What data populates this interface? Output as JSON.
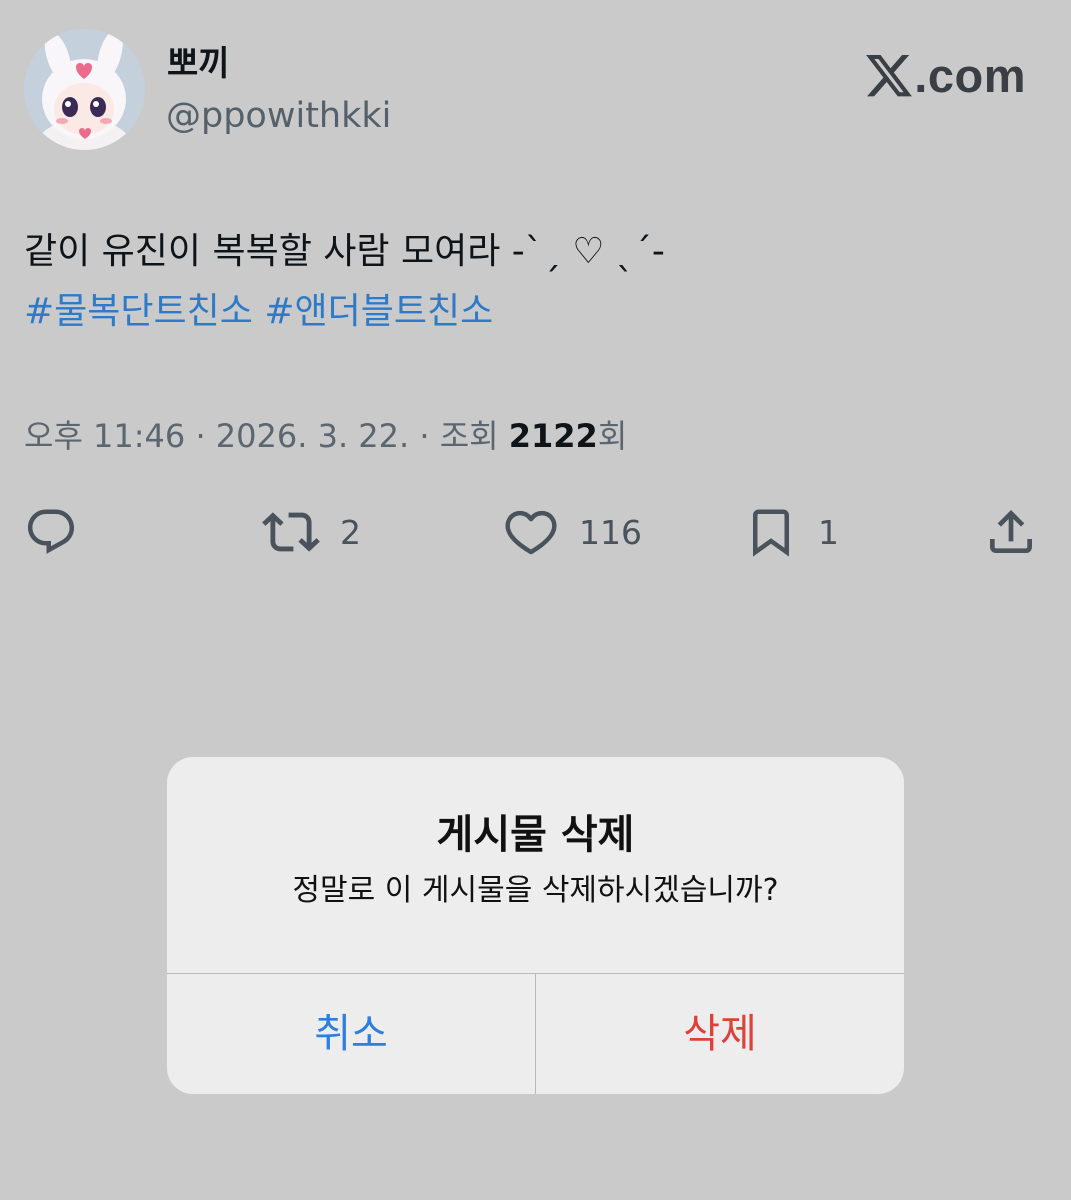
{
  "author": {
    "display_name": "뽀끼",
    "handle": "@ppowithkki"
  },
  "brand": {
    "logo_icon": "x-logo-icon",
    "text": ".com"
  },
  "tweet": {
    "text": "같이 유진이 복복할 사람 모여라  -ˋˏ ♡ ˎˊ-",
    "hashtags": [
      "#물복단트친소",
      "#앤더블트친소"
    ]
  },
  "meta": {
    "time": "오후 11:46",
    "separator": " · ",
    "date": "2026. 3. 22.",
    "views_label": "조회 ",
    "views_count": "2122",
    "views_suffix": "회"
  },
  "actions": {
    "reply": {
      "icon": "reply-icon"
    },
    "retweet": {
      "icon": "retweet-icon",
      "count": "2"
    },
    "like": {
      "icon": "heart-icon",
      "count": "116"
    },
    "bookmark": {
      "icon": "bookmark-icon",
      "count": "1"
    },
    "share": {
      "icon": "share-icon"
    }
  },
  "dialog": {
    "title": "게시물 삭제",
    "message": "정말로 이 게시물을 삭제하시겠습니까?",
    "cancel_label": "취소",
    "delete_label": "삭제"
  },
  "colors": {
    "background": "#cacaca",
    "hashtag": "#2f7ac8",
    "dialog_background": "#ededed",
    "cancel_button": "#2f7ddd",
    "delete_button": "#e0403a"
  }
}
